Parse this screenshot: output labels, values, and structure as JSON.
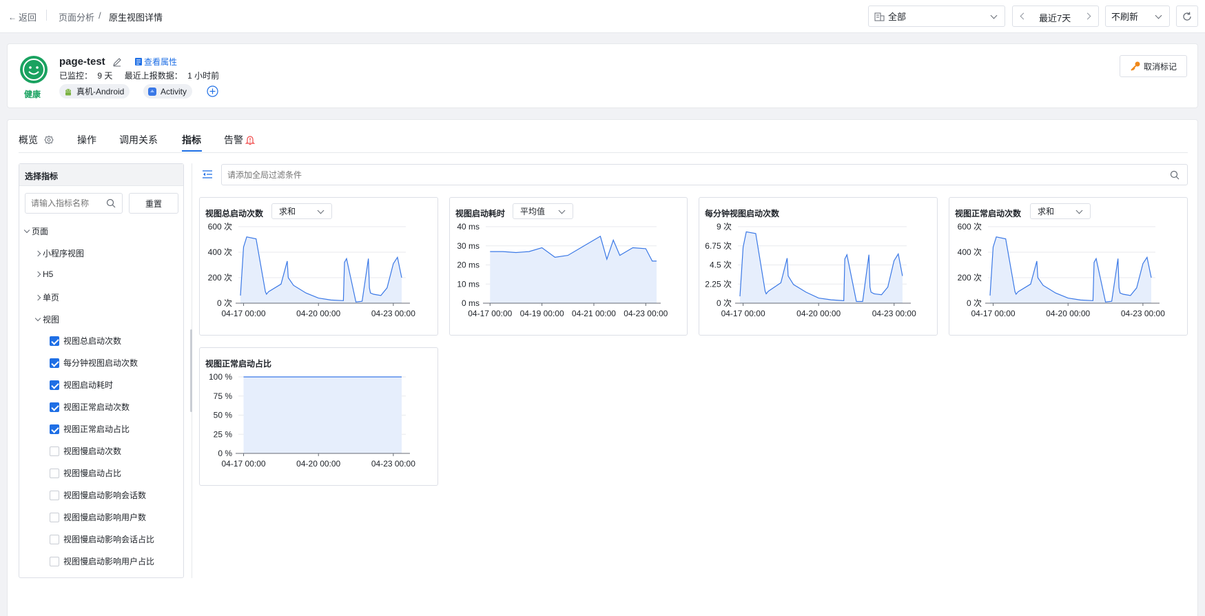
{
  "topbar": {
    "back_label": "返回",
    "breadcrumb": [
      "页面分析",
      "原生视图详情"
    ],
    "breadcrumb_sep": "/",
    "scope_select": "全部",
    "time_range": "最近7天",
    "refresh_select": "不刷新"
  },
  "summary": {
    "status": "健康",
    "status_color": "#1aa260",
    "name": "page-test",
    "view_props_link": "查看属性",
    "monitored_label": "已监控：",
    "monitored_value": "9 天",
    "last_report_label": "最近上报数据：",
    "last_report_value": "1 小时前",
    "tags": [
      {
        "icon": "android-icon",
        "label": "真机-Android"
      },
      {
        "icon": "activity-icon",
        "label": "Activity"
      }
    ],
    "unmark_button": "取消标记"
  },
  "tabs": [
    {
      "label": "概览",
      "active": false
    },
    {
      "label": "操作",
      "active": false
    },
    {
      "label": "调用关系",
      "active": false
    },
    {
      "label": "指标",
      "active": true
    },
    {
      "label": "告警",
      "active": false
    }
  ],
  "metric_panel": {
    "title": "选择指标",
    "search_placeholder": "请输入指标名称",
    "reset_button": "重置",
    "tree": [
      {
        "label": "页面",
        "level": 0,
        "expanded": true
      },
      {
        "label": "小程序视图",
        "level": 1,
        "expanded": false
      },
      {
        "label": "H5",
        "level": 1,
        "expanded": false
      },
      {
        "label": "单页",
        "level": 1,
        "expanded": false
      },
      {
        "label": "视图",
        "level": 1,
        "expanded": true
      }
    ],
    "metrics": [
      {
        "label": "视图总启动次数",
        "checked": true
      },
      {
        "label": "每分钟视图启动次数",
        "checked": true
      },
      {
        "label": "视图启动耗时",
        "checked": true
      },
      {
        "label": "视图正常启动次数",
        "checked": true
      },
      {
        "label": "视图正常启动占比",
        "checked": true
      },
      {
        "label": "视图慢启动次数",
        "checked": false
      },
      {
        "label": "视图慢启动占比",
        "checked": false
      },
      {
        "label": "视图慢启动影响会话数",
        "checked": false
      },
      {
        "label": "视图慢启动影响用户数",
        "checked": false
      },
      {
        "label": "视图慢启动影响会话占比",
        "checked": false
      },
      {
        "label": "视图慢启动影响用户占比",
        "checked": false
      }
    ]
  },
  "filter": {
    "placeholder": "请添加全局过滤条件"
  },
  "colors": {
    "accent": "#1f6fe5",
    "series_line": "#3a78e6",
    "series_fill": "#e6eefc",
    "alert": "#f04848",
    "key_icon": "#f0881a"
  },
  "charts": [
    {
      "title": "视图总启动次数",
      "agg": "求和",
      "yticks": [
        "600 次",
        "400 次",
        "200 次",
        "0 次"
      ],
      "xticks": [
        "04-17 00:00",
        "04-20 00:00",
        "04-23 00:00"
      ]
    },
    {
      "title": "视图启动耗时",
      "agg": "平均值",
      "yticks": [
        "40 ms",
        "30 ms",
        "20 ms",
        "10 ms",
        "0 ms"
      ],
      "xticks": [
        "04-17 00:00",
        "04-19 00:00",
        "04-21 00:00",
        "04-23 00:00"
      ]
    },
    {
      "title": "每分钟视图启动次数",
      "agg": "",
      "yticks": [
        "9 次",
        "6.75 次",
        "4.5 次",
        "2.25 次",
        "0 次"
      ],
      "xticks": [
        "04-17 00:00",
        "04-20 00:00",
        "04-23 00:00"
      ]
    },
    {
      "title": "视图正常启动次数",
      "agg": "求和",
      "yticks": [
        "600 次",
        "400 次",
        "200 次",
        "0 次"
      ],
      "xticks": [
        "04-17 00:00",
        "04-20 00:00",
        "04-23 00:00"
      ]
    },
    {
      "title": "视图正常启动占比",
      "agg": "",
      "yticks": [
        "100 %",
        "75 %",
        "50 %",
        "25 %",
        "0 %"
      ],
      "xticks": [
        "04-17 00:00",
        "04-20 00:00",
        "04-23 00:00"
      ]
    }
  ],
  "chart_data": [
    {
      "type": "area",
      "title": "视图总启动次数",
      "x": [
        "04-16 21:00",
        "04-17 00:00",
        "04-17 03:00",
        "04-17 12:00",
        "04-17 21:00",
        "04-17 22:00",
        "04-18 00:00",
        "04-18 12:00",
        "04-18 18:00",
        "04-18 19:00",
        "04-19 00:00",
        "04-19 12:00",
        "04-20 00:00",
        "04-20 12:00",
        "04-21 00:00",
        "04-21 01:00",
        "04-21 03:00",
        "04-21 12:00",
        "04-21 18:00",
        "04-22 00:00",
        "04-22 01:00",
        "04-22 02:00",
        "04-22 05:00",
        "04-22 12:00",
        "04-22 18:00",
        "04-23 00:00",
        "04-23 04:00",
        "04-23 08:00"
      ],
      "values": [
        60,
        440,
        520,
        505,
        90,
        70,
        90,
        150,
        330,
        200,
        140,
        80,
        40,
        25,
        20,
        320,
        350,
        10,
        15,
        350,
        120,
        80,
        70,
        60,
        120,
        310,
        360,
        200
      ],
      "ylim": [
        0,
        600
      ]
    },
    {
      "type": "area",
      "title": "视图启动耗时",
      "x": [
        "04-17 00:00",
        "04-17 12:00",
        "04-18 00:00",
        "04-18 12:00",
        "04-19 00:00",
        "04-19 12:00",
        "04-20 00:00",
        "04-20 12:00",
        "04-21 00:00",
        "04-21 06:00",
        "04-21 12:00",
        "04-21 18:00",
        "04-22 00:00",
        "04-22 12:00",
        "04-23 00:00",
        "04-23 06:00",
        "04-23 10:00"
      ],
      "values": [
        27,
        27,
        26.5,
        27,
        29,
        24,
        25,
        29,
        33,
        35,
        23,
        33,
        25,
        29,
        28.5,
        22,
        22
      ],
      "ylim": [
        0,
        40
      ]
    },
    {
      "type": "area",
      "title": "每分钟视图启动次数",
      "x": [
        "04-16 21:00",
        "04-17 00:00",
        "04-17 03:00",
        "04-17 12:00",
        "04-17 21:00",
        "04-17 22:00",
        "04-18 00:00",
        "04-18 12:00",
        "04-18 18:00",
        "04-18 19:00",
        "04-19 00:00",
        "04-19 12:00",
        "04-20 00:00",
        "04-20 12:00",
        "04-21 00:00",
        "04-21 01:00",
        "04-21 03:00",
        "04-21 12:00",
        "04-21 18:00",
        "04-22 00:00",
        "04-22 01:00",
        "04-22 02:00",
        "04-22 05:00",
        "04-22 12:00",
        "04-22 18:00",
        "04-23 00:00",
        "04-23 04:00",
        "04-23 08:00"
      ],
      "values": [
        0.8,
        6.6,
        8.4,
        8.2,
        1.4,
        1.1,
        1.4,
        2.4,
        5.3,
        3.2,
        2.2,
        1.3,
        0.6,
        0.4,
        0.3,
        5.2,
        5.7,
        0.2,
        0.2,
        5.7,
        1.9,
        1.3,
        1.1,
        1,
        1.9,
        5,
        5.8,
        3.2
      ],
      "ylim": [
        0,
        9
      ]
    },
    {
      "type": "area",
      "title": "视图正常启动次数",
      "x": [
        "04-16 21:00",
        "04-17 00:00",
        "04-17 03:00",
        "04-17 12:00",
        "04-17 21:00",
        "04-17 22:00",
        "04-18 00:00",
        "04-18 12:00",
        "04-18 18:00",
        "04-18 19:00",
        "04-19 00:00",
        "04-19 12:00",
        "04-20 00:00",
        "04-20 12:00",
        "04-21 00:00",
        "04-21 01:00",
        "04-21 03:00",
        "04-21 12:00",
        "04-21 18:00",
        "04-22 00:00",
        "04-22 01:00",
        "04-22 02:00",
        "04-22 05:00",
        "04-22 12:00",
        "04-22 18:00",
        "04-23 00:00",
        "04-23 04:00",
        "04-23 08:00"
      ],
      "values": [
        60,
        440,
        520,
        505,
        90,
        70,
        90,
        150,
        330,
        200,
        140,
        80,
        40,
        25,
        20,
        320,
        350,
        10,
        15,
        350,
        120,
        80,
        70,
        60,
        120,
        310,
        360,
        200
      ],
      "ylim": [
        0,
        600
      ]
    },
    {
      "type": "area",
      "title": "视图正常启动占比",
      "x": [
        "04-17 00:00",
        "04-20 00:00",
        "04-23 00:00",
        "04-23 08:00"
      ],
      "values": [
        100,
        100,
        100,
        100
      ],
      "ylim": [
        0,
        100
      ]
    }
  ]
}
